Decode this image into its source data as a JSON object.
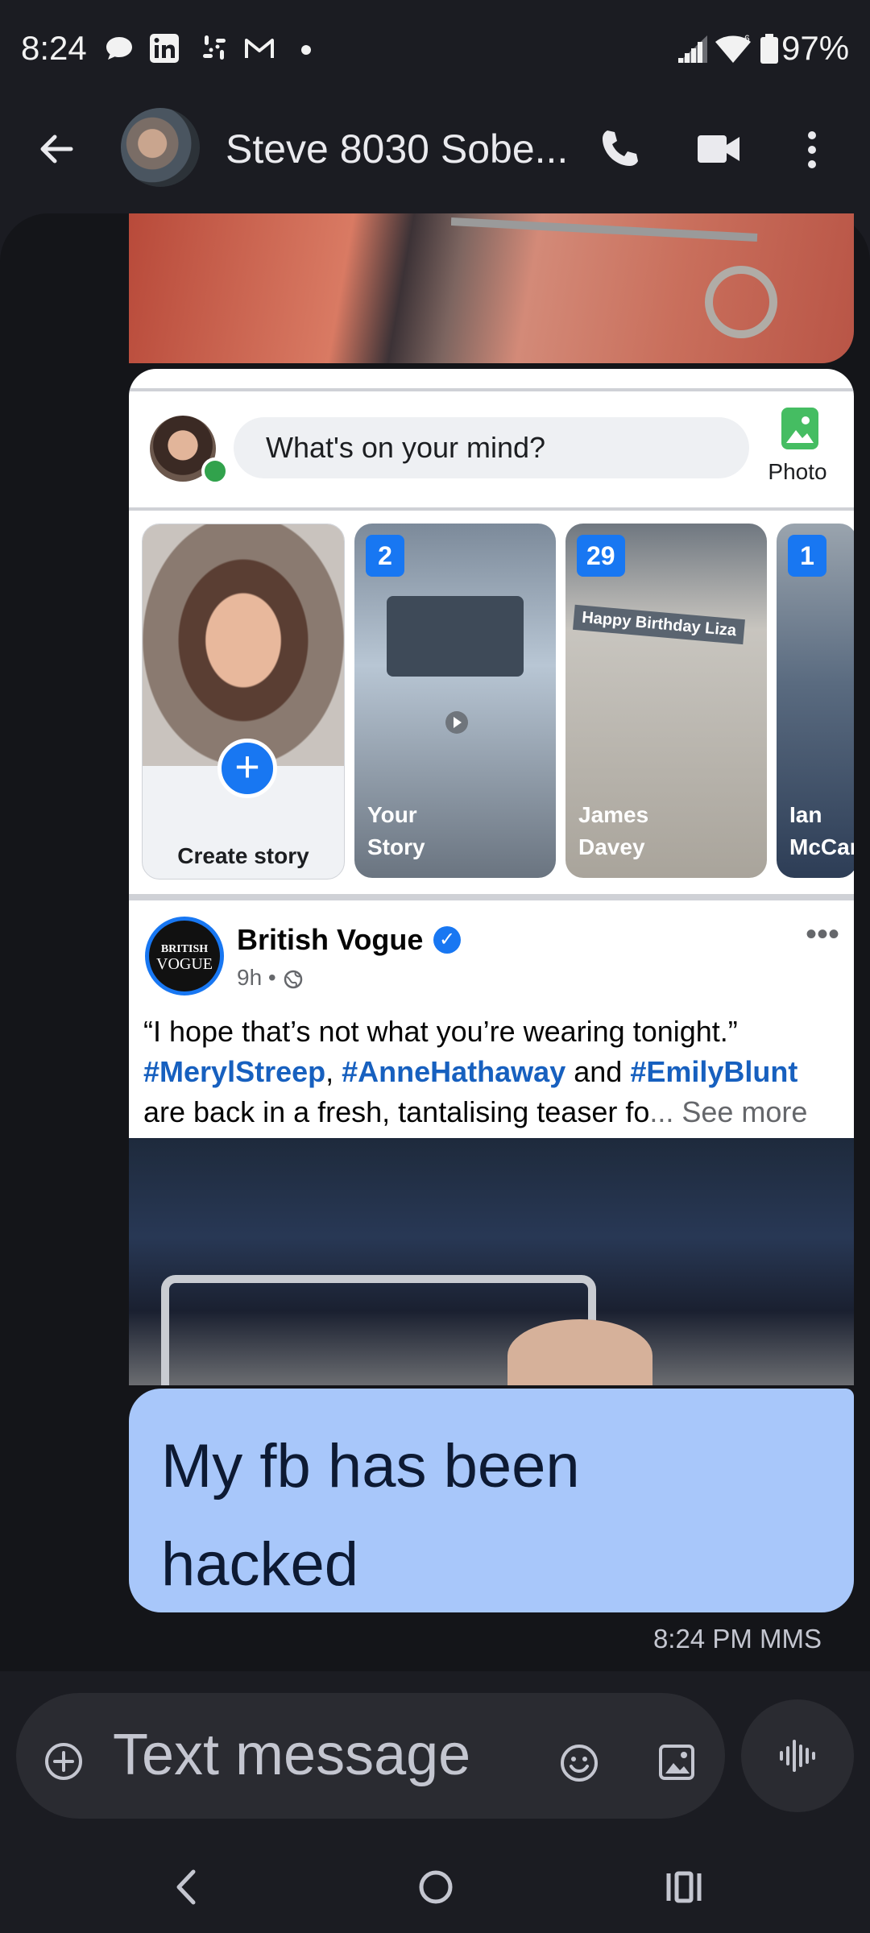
{
  "status_bar": {
    "time": "8:24",
    "battery": "97%",
    "icons": [
      "chat-bubble-icon",
      "linkedin-icon",
      "slack-icon",
      "gmail-icon",
      "dot-icon",
      "signal-icon",
      "wifi-icon",
      "battery-icon"
    ]
  },
  "header": {
    "contact_name": "Steve 8030 Sobe...",
    "icons": [
      "back-arrow-icon",
      "phone-icon",
      "video-call-icon",
      "more-vert-icon"
    ]
  },
  "screenshot_post": {
    "composer_placeholder": "What's on your mind?",
    "photo_label": "Photo",
    "stories": [
      {
        "label": "Create story",
        "badge": ""
      },
      {
        "label": "Your\nStory",
        "badge": "2"
      },
      {
        "label": "James\nDavey",
        "badge": "29",
        "overlay": "Happy Birthday Liza"
      },
      {
        "label": "Ian\nMcCar",
        "badge": "1"
      }
    ],
    "page_name": "British Vogue",
    "logo_text_top": "BRITISH",
    "logo_text_bottom": "VOGUE",
    "post_time": "9h •",
    "text_quote": "“I hope that’s not what you’re wearing tonight.”",
    "tag1": "#MerylStreep",
    "sep1": ",",
    "tag2": "#AnneHathaway",
    "sep2": " and ",
    "tag3": "#EmilyBlunt",
    "text_rest": "are back in a fresh, tantalising teaser fo",
    "see_more": "... See more"
  },
  "message": {
    "text_line1": "My fb has been",
    "text_line2": "hacked",
    "meta": "8:24 PM MMS"
  },
  "compose": {
    "placeholder": "Text message"
  }
}
